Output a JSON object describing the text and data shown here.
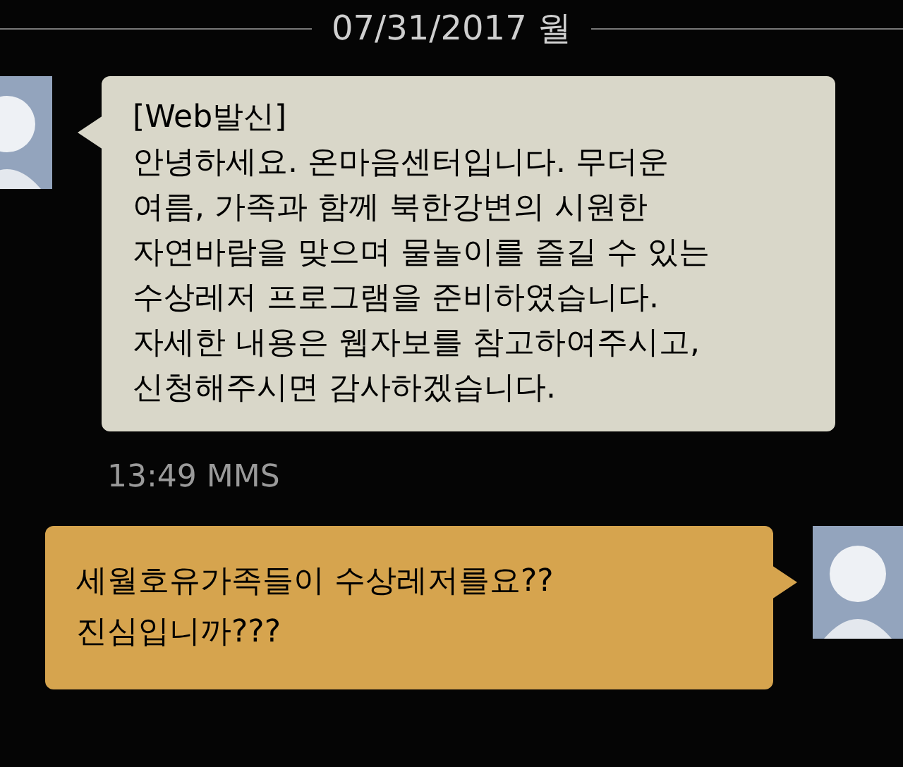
{
  "date_header": "07/31/2017 월",
  "messages": [
    {
      "kind": "incoming",
      "text": "[Web발신]\n안녕하세요. 온마음센터입니다. 무더운\n여름, 가족과 함께 북한강변의 시원한\n자연바람을 맞으며 물놀이를 즐길 수 있는\n수상레저 프로그램을 준비하였습니다.\n자세한 내용은 웹자보를 참고하여주시고,\n신청해주시면 감사하겠습니다.",
      "meta": "13:49 MMS"
    },
    {
      "kind": "outgoing",
      "text": "세월호유가족들이 수상레저를요??\n진심입니까???"
    }
  ]
}
